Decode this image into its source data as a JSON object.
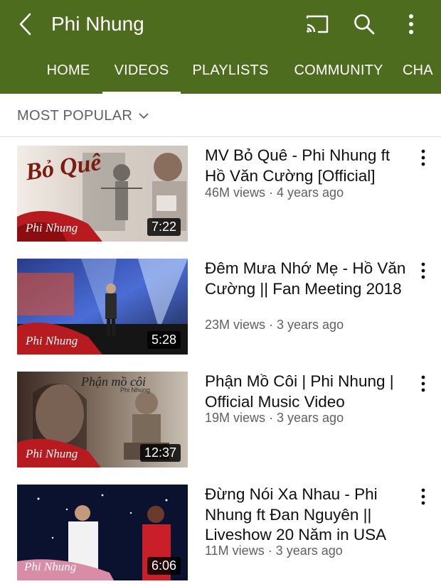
{
  "header": {
    "channel_name": "Phi Nhung",
    "icons": [
      "back-arrow-icon",
      "cast-icon",
      "search-icon",
      "more-vert-icon"
    ]
  },
  "tabs": [
    {
      "label": "HOME",
      "active": false
    },
    {
      "label": "VIDEOS",
      "active": true
    },
    {
      "label": "PLAYLISTS",
      "active": false
    },
    {
      "label": "COMMUNITY",
      "active": false
    },
    {
      "label": "CHA",
      "active": false
    }
  ],
  "sort": {
    "label": "MOST POPULAR",
    "icon": "chevron-down-icon"
  },
  "videos": [
    {
      "title": "MV Bỏ Quê - Phi Nhung ft Hồ Văn Cường [Official]",
      "meta": "46M views · 4 years ago",
      "duration": "7:22",
      "thumb_text": "Bỏ Quê",
      "watermark": "Phi Nhung"
    },
    {
      "title": "Đêm Mưa Nhớ Mẹ - Hồ Văn Cường || Fan Meeting 2018",
      "meta": "23M views · 3 years ago",
      "duration": "5:28",
      "watermark": "Phi Nhung"
    },
    {
      "title": "Phận Mồ Côi | Phi Nhung | Official Music Video",
      "meta": "19M views · 3 years ago",
      "duration": "12:37",
      "thumb_text": "Phận mồ côi",
      "thumb_subtext": "Phi Nhung",
      "watermark": "Phi Nhung"
    },
    {
      "title": "Đừng Nói Xa Nhau - Phi Nhung ft Đan Nguyên || Liveshow 20 Năm in USA",
      "meta": "11M views · 3 years ago",
      "duration": "6:06",
      "watermark": "Phi Nhung"
    }
  ],
  "colors": {
    "header_bg": "#4e6c1d",
    "text_primary": "#0f0f0f",
    "text_secondary": "#606060"
  }
}
